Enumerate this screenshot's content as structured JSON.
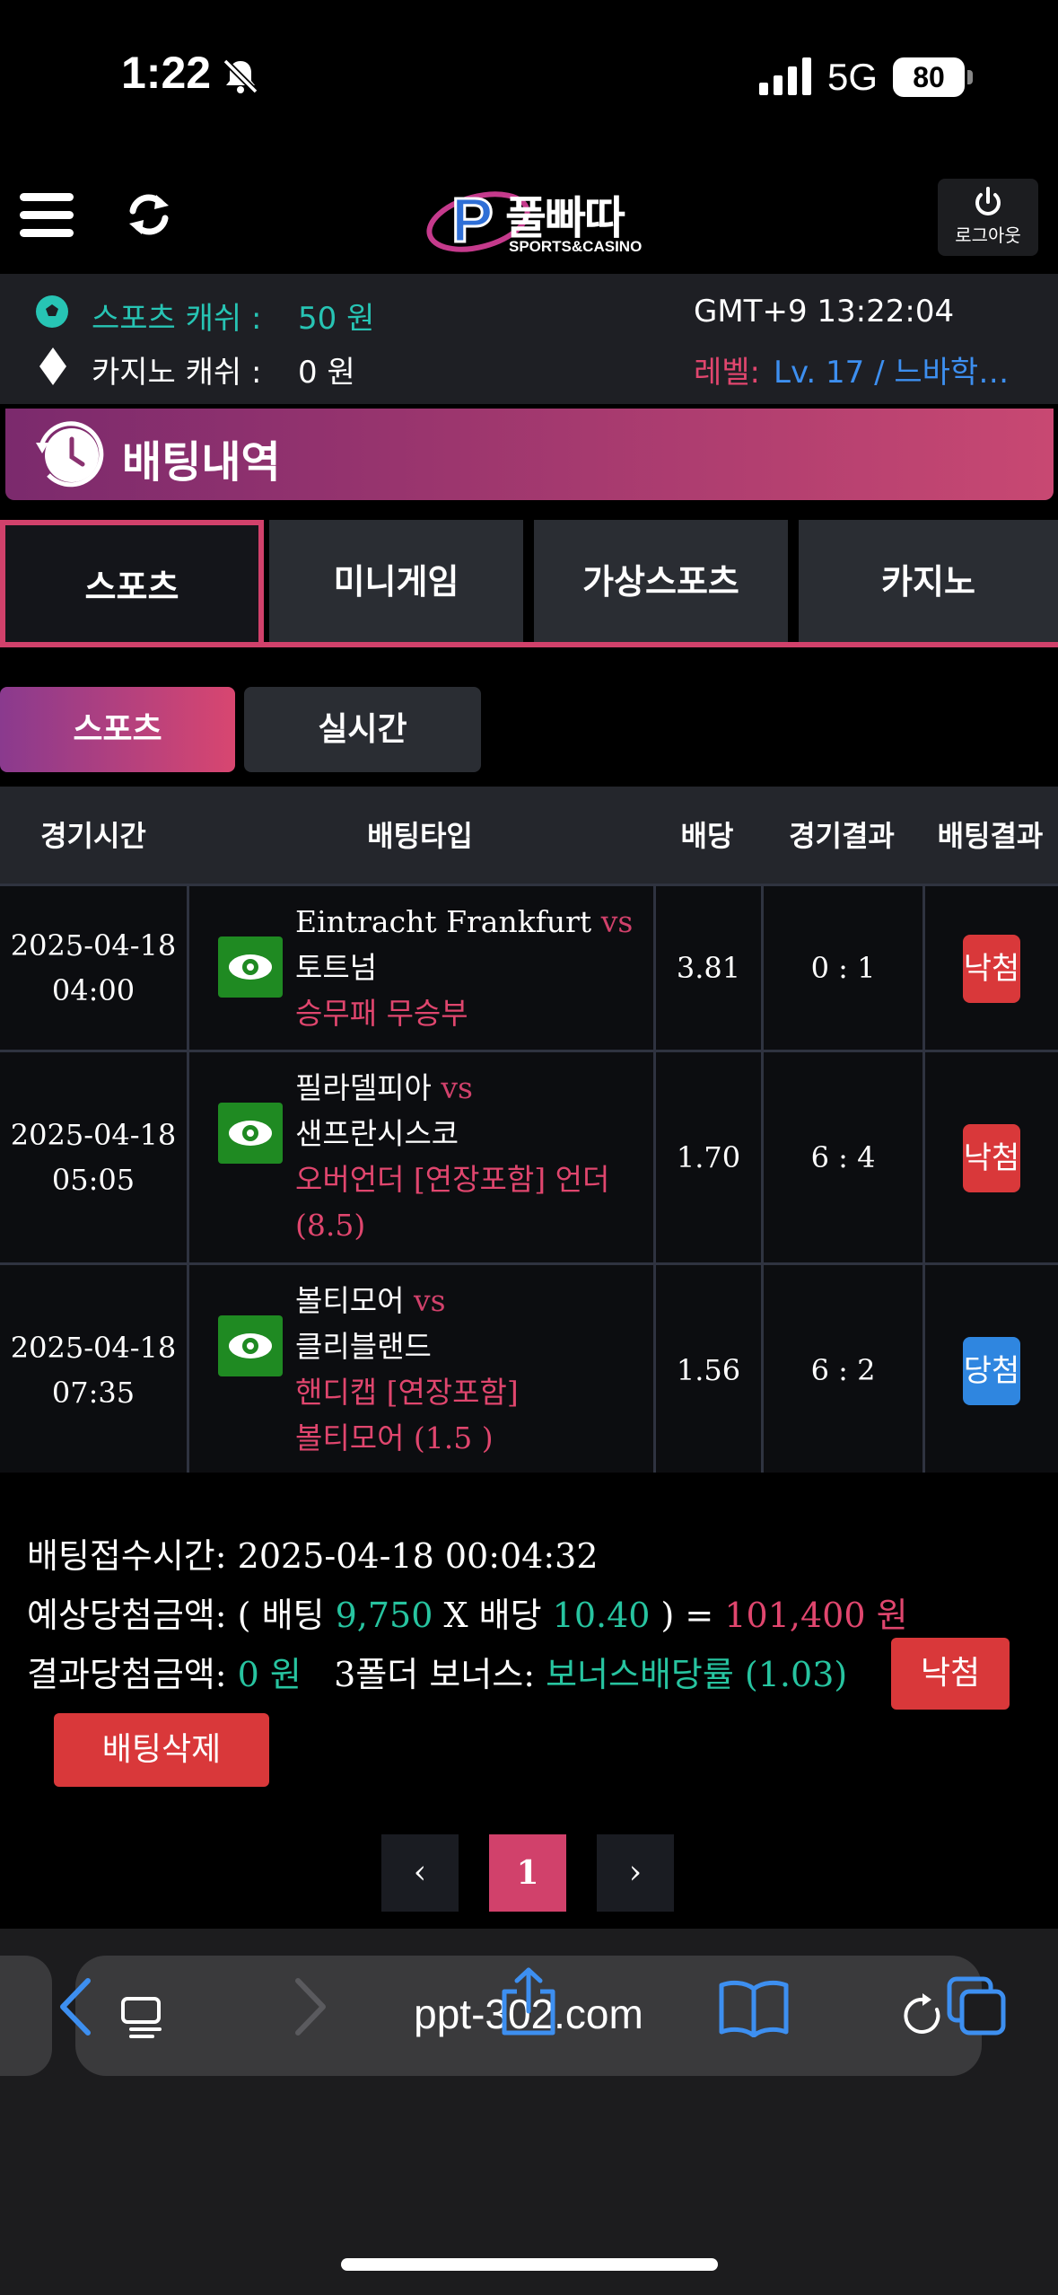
{
  "status_bar": {
    "time": "1:22",
    "network": "5G",
    "battery": "80"
  },
  "header": {
    "logo_text": "풀빠따",
    "logo_sub": "SPORTS&CASINO",
    "logout_label": "로그아웃"
  },
  "info": {
    "sports_cash_label": "스포츠 캐쉬 :",
    "sports_cash_value": "50 원",
    "casino_cash_label": "카지노 캐쉬 :",
    "casino_cash_value": "0 원",
    "clock": "GMT+9 13:22:04",
    "level_label": "레벨:",
    "level_value": "Lv. 17 / 느바학…"
  },
  "page_title": "배팅내역",
  "category_tabs": [
    {
      "label": "스포츠",
      "active": true
    },
    {
      "label": "미니게임",
      "active": false
    },
    {
      "label": "가상스포츠",
      "active": false
    },
    {
      "label": "카지노",
      "active": false
    }
  ],
  "sub_tabs": [
    {
      "label": "스포츠",
      "active": true
    },
    {
      "label": "실시간",
      "active": false
    }
  ],
  "table": {
    "headers": [
      "경기시간",
      "배팅타입",
      "배당",
      "경기결과",
      "배팅결과"
    ],
    "rows": [
      {
        "date": "2025-04-18",
        "time": "04:00",
        "home": "Eintracht Frankfurt",
        "vs": "vs",
        "away": "토트넘",
        "bet_type_1": "승무패 무승부",
        "bet_type_2": "",
        "odds": "3.81",
        "score": "0 : 1",
        "result": "낙첨",
        "result_color": "#d9383a"
      },
      {
        "date": "2025-04-18",
        "time": "05:05",
        "home": "필라델피아",
        "vs": "vs",
        "away": "샌프란시스코",
        "bet_type_1": "오버언더 [연장포함] 언더",
        "bet_type_2": "(8.5)",
        "odds": "1.70",
        "score": "6 : 4",
        "result": "낙첨",
        "result_color": "#d9383a"
      },
      {
        "date": "2025-04-18",
        "time": "07:35",
        "home": "볼티모어",
        "vs": "vs",
        "away": "클리블랜드",
        "bet_type_1": "핸디캡 [연장포함]",
        "bet_type_2": "볼티모어 (1.5 )",
        "odds": "1.56",
        "score": "6 : 2",
        "result": "당첨",
        "result_color": "#2f86e0"
      }
    ]
  },
  "summary": {
    "received_label": "배팅접수시간:",
    "received_value": "2025-04-18 00:04:32",
    "expected_label": "예상당첨금액:",
    "expected_open": "( 배팅",
    "bet_amount": "9,750",
    "times": "X 배당",
    "total_odds": "10.40",
    "close_eq": ") =",
    "expected_amount": "101,400 원",
    "result_label": "결과당첨금액:",
    "result_amount": "0 원",
    "bonus_label": "3폴더 보너스:",
    "bonus_value": "보너스배당률 (1.03)",
    "status_badge": "낙첨",
    "delete_button": "배팅삭제"
  },
  "pagination": {
    "prev": "‹",
    "current": "1",
    "next": "›"
  },
  "browser": {
    "url": "ppt-302.com"
  }
}
